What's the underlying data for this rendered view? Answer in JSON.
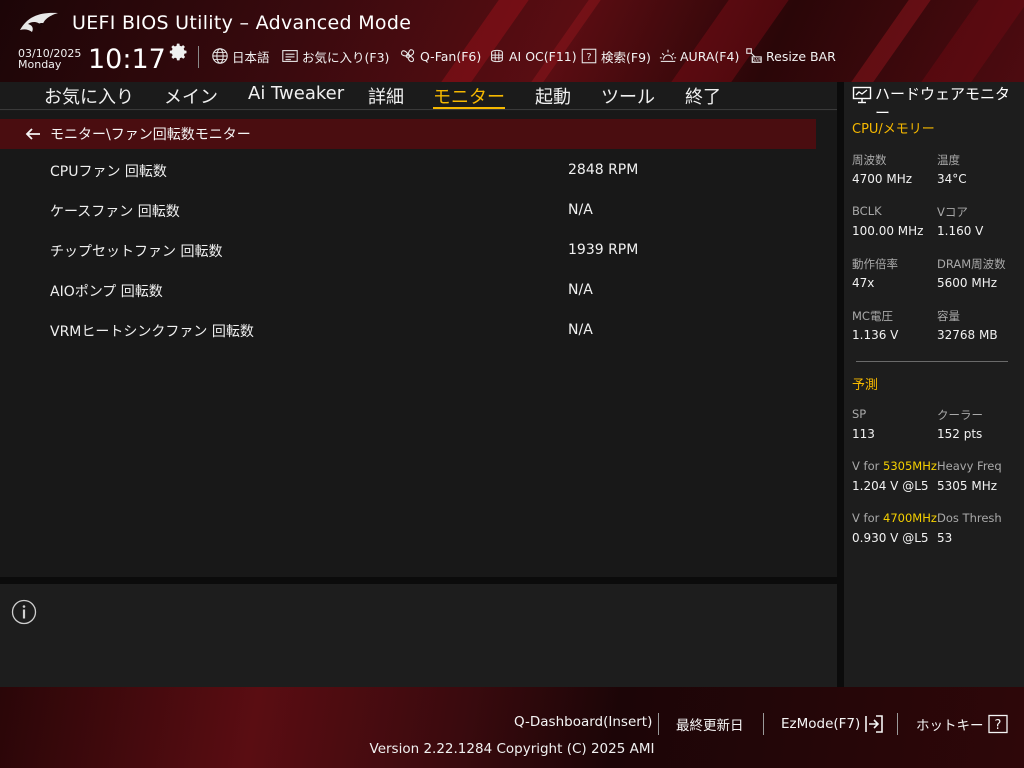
{
  "header": {
    "title": "UEFI BIOS Utility – Advanced Mode",
    "date": "03/10/2025",
    "weekday": "Monday",
    "time": "10:17",
    "tools": [
      {
        "icon": "globe-icon",
        "label": "日本語"
      },
      {
        "icon": "favorites-icon",
        "label": "お気に入り(F3)"
      },
      {
        "icon": "fan-icon",
        "label": "Q-Fan(F6)"
      },
      {
        "icon": "ai-oc-icon",
        "label": "AI OC(F11)"
      },
      {
        "icon": "help-search-icon",
        "label": "検索(F9)"
      },
      {
        "icon": "aura-icon",
        "label": "AURA(F4)"
      },
      {
        "icon": "resize-bar-icon",
        "label": "Resize BAR"
      }
    ]
  },
  "nav": {
    "tabs": [
      {
        "label": "お気に入り"
      },
      {
        "label": "メイン"
      },
      {
        "label": "Ai Tweaker"
      },
      {
        "label": "詳細"
      },
      {
        "label": "モニター",
        "active": true
      },
      {
        "label": "起動"
      },
      {
        "label": "ツール"
      },
      {
        "label": "終了"
      }
    ]
  },
  "main": {
    "breadcrumb": "モニター\\ファン回転数モニター",
    "rows": [
      {
        "label": "CPUファン 回転数",
        "value": "2848 RPM"
      },
      {
        "label": "ケースファン 回転数",
        "value": "N/A"
      },
      {
        "label": "チップセットファン 回転数",
        "value": "1939 RPM"
      },
      {
        "label": "AIOポンプ 回転数",
        "value": "N/A"
      },
      {
        "label": "VRMヒートシンクファン 回転数",
        "value": "N/A"
      }
    ]
  },
  "hw_monitor": {
    "title": "ハードウェアモニター",
    "cpu_section": "CPU/メモリー",
    "cpu": [
      {
        "label": "周波数",
        "value": "4700 MHz"
      },
      {
        "label": "温度",
        "value": "34°C"
      },
      {
        "label": "BCLK",
        "value": "100.00 MHz"
      },
      {
        "label": "Vコア",
        "value": "1.160 V"
      },
      {
        "label": "動作倍率",
        "value": "47x"
      },
      {
        "label": "DRAM周波数",
        "value": "5600 MHz"
      },
      {
        "label": "MC電圧",
        "value": "1.136 V"
      },
      {
        "label": "容量",
        "value": "32768 MB"
      }
    ],
    "pred_section": "予測",
    "prediction": [
      {
        "label": "SP",
        "value": "113"
      },
      {
        "label": "クーラー",
        "value": "152 pts"
      },
      {
        "label_prefix": "V for ",
        "label_highlight": "5305MHz",
        "value": "1.204 V @L5"
      },
      {
        "label": "Heavy Freq",
        "value": "5305 MHz"
      },
      {
        "label_prefix": "V for ",
        "label_highlight": "4700MHz",
        "value": "0.930 V @L5"
      },
      {
        "label": "Dos Thresh",
        "value": "53"
      }
    ]
  },
  "footer": {
    "qdashboard": "Q-Dashboard(Insert)",
    "last_modified": "最終更新日",
    "ezmode": "EzMode(F7)",
    "hotkeys": "ホットキー",
    "version": "Version 2.22.1284 Copyright (C) 2025 AMI"
  },
  "colors": {
    "accent": "#f5b800",
    "highlight": "#f5d000",
    "breadcrumb_bg": "#4a0d10",
    "panel_bg": "#1d1d1d"
  }
}
